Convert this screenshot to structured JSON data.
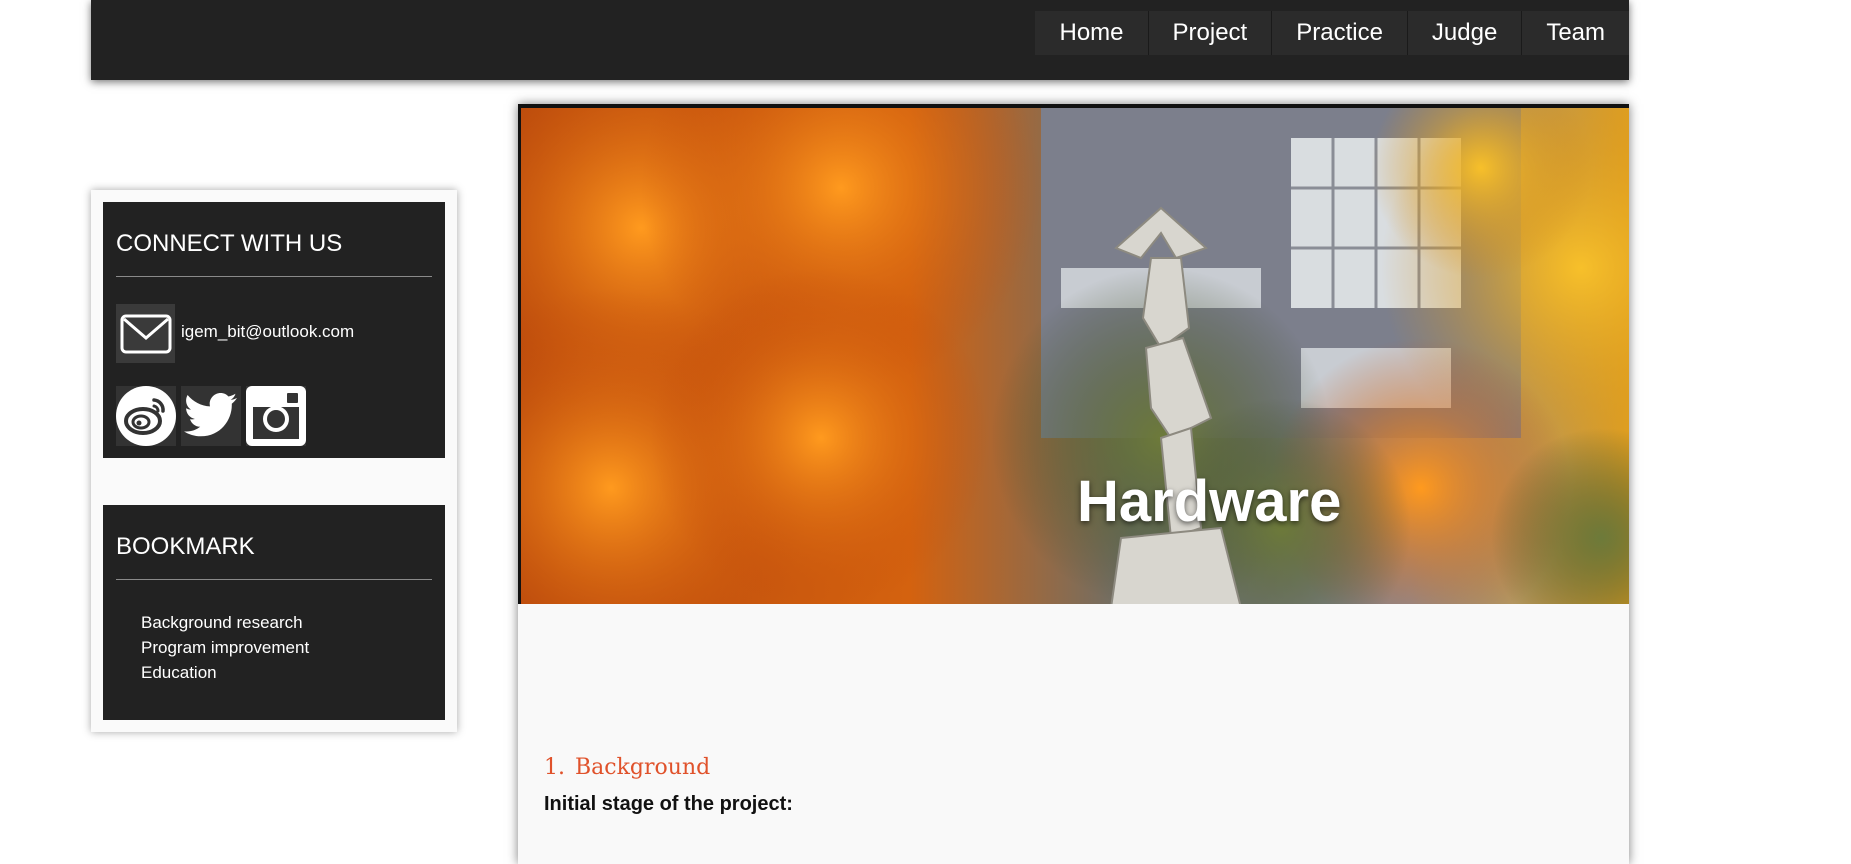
{
  "nav": {
    "items": [
      "Home",
      "Project",
      "Practice",
      "Judge",
      "Team"
    ]
  },
  "connect": {
    "title": "CONNECT WITH US",
    "email": "igem_bit@outlook.com",
    "social_icons": [
      "weibo-icon",
      "twitter-icon",
      "instagram-icon"
    ]
  },
  "bookmark": {
    "title": "BOOKMARK",
    "items": [
      "Background research",
      "Program improvement",
      "Education"
    ]
  },
  "hero": {
    "title": "Hardware"
  },
  "content": {
    "section_number": "1.",
    "section_title": "Background",
    "subheading": "Initial stage of the project:"
  },
  "colors": {
    "dark_panel": "#222222",
    "accent_heading": "#e0522b",
    "page_background": "#f9f9f9"
  }
}
